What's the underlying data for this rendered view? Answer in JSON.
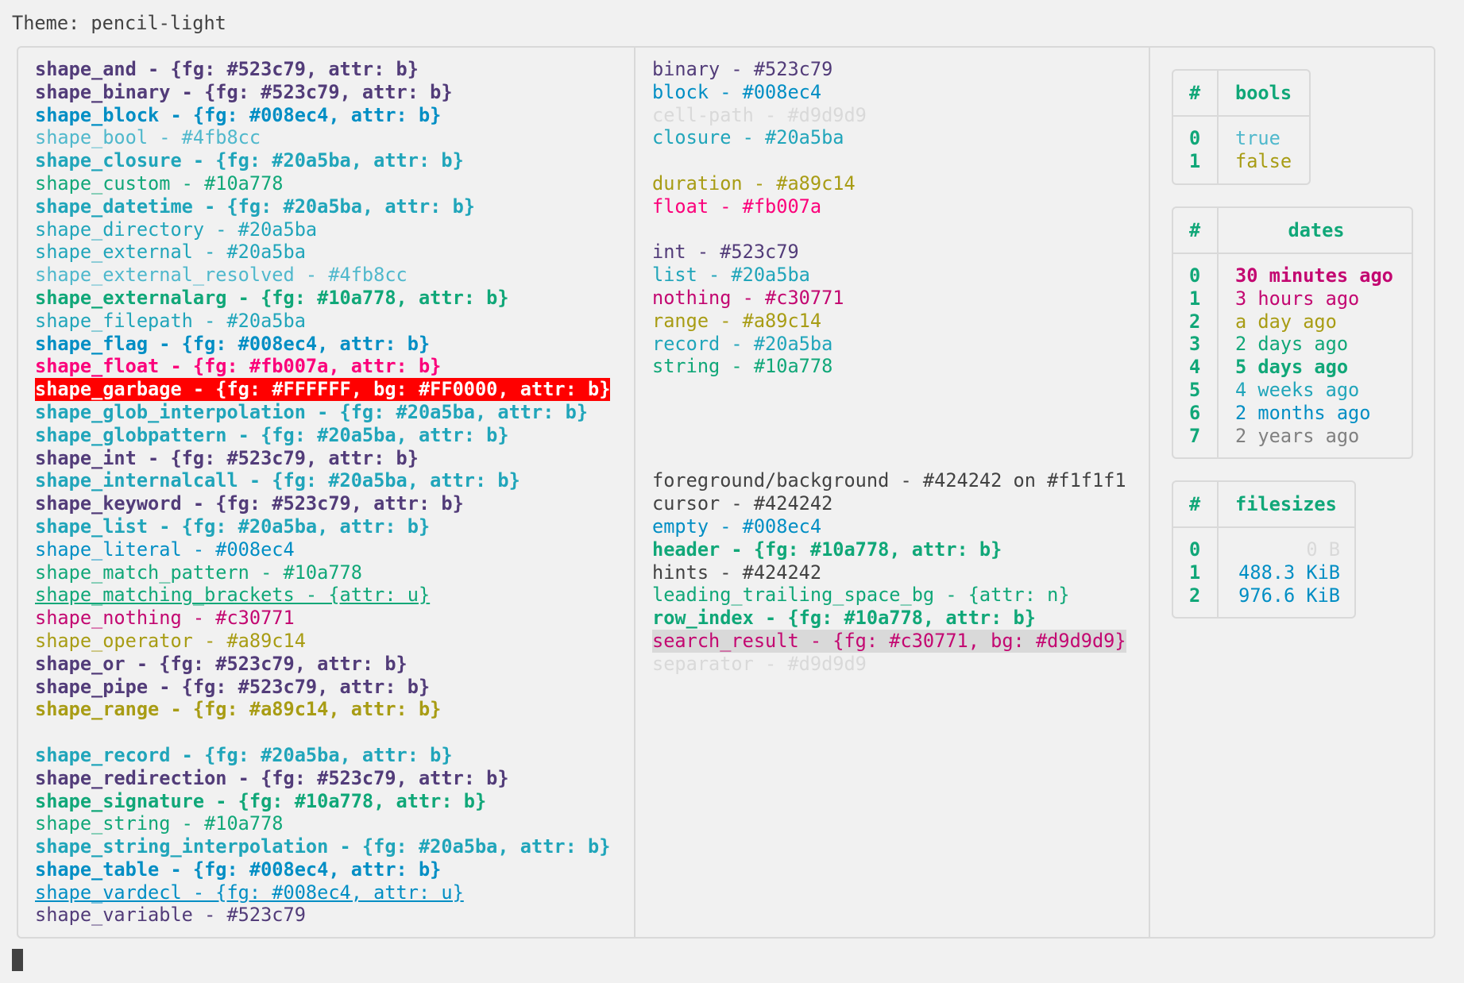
{
  "title": "Theme: pencil-light",
  "col1": [
    {
      "text": "shape_and - {fg: #523c79, attr: b}",
      "color": "#523c79",
      "style": "b"
    },
    {
      "text": "shape_binary - {fg: #523c79, attr: b}",
      "color": "#523c79",
      "style": "b"
    },
    {
      "text": "shape_block - {fg: #008ec4, attr: b}",
      "color": "#008ec4",
      "style": "b"
    },
    {
      "text": "shape_bool - #4fb8cc",
      "color": "#4fb8cc",
      "style": ""
    },
    {
      "text": "shape_closure - {fg: #20a5ba, attr: b}",
      "color": "#20a5ba",
      "style": "b"
    },
    {
      "text": "shape_custom - #10a778",
      "color": "#10a778",
      "style": ""
    },
    {
      "text": "shape_datetime - {fg: #20a5ba, attr: b}",
      "color": "#20a5ba",
      "style": "b"
    },
    {
      "text": "shape_directory - #20a5ba",
      "color": "#20a5ba",
      "style": ""
    },
    {
      "text": "shape_external - #20a5ba",
      "color": "#20a5ba",
      "style": ""
    },
    {
      "text": "shape_external_resolved - #4fb8cc",
      "color": "#4fb8cc",
      "style": ""
    },
    {
      "text": "shape_externalarg - {fg: #10a778, attr: b}",
      "color": "#10a778",
      "style": "b"
    },
    {
      "text": "shape_filepath - #20a5ba",
      "color": "#20a5ba",
      "style": ""
    },
    {
      "text": "shape_flag - {fg: #008ec4, attr: b}",
      "color": "#008ec4",
      "style": "b"
    },
    {
      "text": "shape_float - {fg: #fb007a, attr: b}",
      "color": "#fb007a",
      "style": "b"
    },
    {
      "text": "shape_garbage - {fg: #FFFFFF, bg: #FF0000, attr: b}",
      "color": "#FFFFFF",
      "style": "garb"
    },
    {
      "text": "shape_glob_interpolation - {fg: #20a5ba, attr: b}",
      "color": "#20a5ba",
      "style": "b"
    },
    {
      "text": "shape_globpattern - {fg: #20a5ba, attr: b}",
      "color": "#20a5ba",
      "style": "b"
    },
    {
      "text": "shape_int - {fg: #523c79, attr: b}",
      "color": "#523c79",
      "style": "b"
    },
    {
      "text": "shape_internalcall - {fg: #20a5ba, attr: b}",
      "color": "#20a5ba",
      "style": "b"
    },
    {
      "text": "shape_keyword - {fg: #523c79, attr: b}",
      "color": "#523c79",
      "style": "b"
    },
    {
      "text": "shape_list - {fg: #20a5ba, attr: b}",
      "color": "#20a5ba",
      "style": "b"
    },
    {
      "text": "shape_literal - #008ec4",
      "color": "#008ec4",
      "style": ""
    },
    {
      "text": "shape_match_pattern - #10a778",
      "color": "#10a778",
      "style": ""
    },
    {
      "text": "shape_matching_brackets - {attr: u}",
      "color": "#10a778",
      "style": "u"
    },
    {
      "text": "shape_nothing - #c30771",
      "color": "#c30771",
      "style": ""
    },
    {
      "text": "shape_operator - #a89c14",
      "color": "#a89c14",
      "style": ""
    },
    {
      "text": "shape_or - {fg: #523c79, attr: b}",
      "color": "#523c79",
      "style": "b"
    },
    {
      "text": "shape_pipe - {fg: #523c79, attr: b}",
      "color": "#523c79",
      "style": "b"
    },
    {
      "text": "shape_range - {fg: #a89c14, attr: b}",
      "color": "#a89c14",
      "style": "b"
    },
    {
      "text": "",
      "color": "#424242",
      "style": ""
    },
    {
      "text": "shape_record - {fg: #20a5ba, attr: b}",
      "color": "#20a5ba",
      "style": "b"
    },
    {
      "text": "shape_redirection - {fg: #523c79, attr: b}",
      "color": "#523c79",
      "style": "b"
    },
    {
      "text": "shape_signature - {fg: #10a778, attr: b}",
      "color": "#10a778",
      "style": "b"
    },
    {
      "text": "shape_string - #10a778",
      "color": "#10a778",
      "style": ""
    },
    {
      "text": "shape_string_interpolation - {fg: #20a5ba, attr: b}",
      "color": "#20a5ba",
      "style": "b"
    },
    {
      "text": "shape_table - {fg: #008ec4, attr: b}",
      "color": "#008ec4",
      "style": "b"
    },
    {
      "text": "shape_vardecl - {fg: #008ec4, attr: u}",
      "color": "#008ec4",
      "style": "u"
    },
    {
      "text": "shape_variable - #523c79",
      "color": "#523c79",
      "style": ""
    }
  ],
  "col2": [
    {
      "text": "binary - #523c79",
      "color": "#523c79",
      "style": ""
    },
    {
      "text": "block - #008ec4",
      "color": "#008ec4",
      "style": ""
    },
    {
      "text": "cell-path - #d9d9d9",
      "color": "#d9d9d9",
      "style": ""
    },
    {
      "text": "closure - #20a5ba",
      "color": "#20a5ba",
      "style": ""
    },
    {
      "text": "",
      "color": "#424242",
      "style": ""
    },
    {
      "text": "duration - #a89c14",
      "color": "#a89c14",
      "style": ""
    },
    {
      "text": "float - #fb007a",
      "color": "#fb007a",
      "style": ""
    },
    {
      "text": "",
      "color": "#424242",
      "style": ""
    },
    {
      "text": "int - #523c79",
      "color": "#523c79",
      "style": ""
    },
    {
      "text": "list - #20a5ba",
      "color": "#20a5ba",
      "style": ""
    },
    {
      "text": "nothing - #c30771",
      "color": "#c30771",
      "style": ""
    },
    {
      "text": "range - #a89c14",
      "color": "#a89c14",
      "style": ""
    },
    {
      "text": "record - #20a5ba",
      "color": "#20a5ba",
      "style": ""
    },
    {
      "text": "string - #10a778",
      "color": "#10a778",
      "style": ""
    },
    {
      "text": "",
      "color": "#424242",
      "style": ""
    },
    {
      "text": "",
      "color": "#424242",
      "style": ""
    },
    {
      "text": "",
      "color": "#424242",
      "style": ""
    },
    {
      "text": "",
      "color": "#424242",
      "style": ""
    },
    {
      "text": "foreground/background - #424242 on #f1f1f1",
      "color": "#424242",
      "style": ""
    },
    {
      "text": "cursor - #424242",
      "color": "#424242",
      "style": ""
    },
    {
      "text": "empty - #008ec4",
      "color": "#008ec4",
      "style": ""
    },
    {
      "text": "header - {fg: #10a778, attr: b}",
      "color": "#10a778",
      "style": "b"
    },
    {
      "text": "hints - #424242",
      "color": "#424242",
      "style": ""
    },
    {
      "text": "leading_trailing_space_bg - {attr: n}",
      "color": "#10a778",
      "style": ""
    },
    {
      "text": "row_index - {fg: #10a778, attr: b}",
      "color": "#10a778",
      "style": "b"
    },
    {
      "text": "search_result - {fg: #c30771, bg: #d9d9d9}",
      "color": "#c30771",
      "style": "sr"
    },
    {
      "text": "separator - #d9d9d9",
      "color": "#d9d9d9",
      "style": ""
    }
  ],
  "tables": {
    "bools": {
      "index_header": "#",
      "header": "bools",
      "rows": [
        {
          "idx": "0",
          "val": "true",
          "color": "#4fb8cc",
          "bold": false
        },
        {
          "idx": "1",
          "val": "false",
          "color": "#a89c14",
          "bold": false
        }
      ]
    },
    "dates": {
      "index_header": "#",
      "header": "dates",
      "rows": [
        {
          "idx": "0",
          "val": "30 minutes ago",
          "color": "#c30771",
          "bold": true
        },
        {
          "idx": "1",
          "val": "3 hours ago",
          "color": "#c30771",
          "bold": false
        },
        {
          "idx": "2",
          "val": "a day ago",
          "color": "#a89c14",
          "bold": false
        },
        {
          "idx": "3",
          "val": "2 days ago",
          "color": "#10a778",
          "bold": false
        },
        {
          "idx": "4",
          "val": "5 days ago",
          "color": "#10a778",
          "bold": true
        },
        {
          "idx": "5",
          "val": "4 weeks ago",
          "color": "#20a5ba",
          "bold": false
        },
        {
          "idx": "6",
          "val": "2 months ago",
          "color": "#008ec4",
          "bold": false
        },
        {
          "idx": "7",
          "val": "2 years ago",
          "color": "#808080",
          "bold": false
        }
      ]
    },
    "filesizes": {
      "index_header": "#",
      "header": "filesizes",
      "rows": [
        {
          "idx": "0",
          "val": "0 B",
          "color": "#d9d9d9",
          "bold": false
        },
        {
          "idx": "1",
          "val": "488.3 KiB",
          "color": "#008ec4",
          "bold": false
        },
        {
          "idx": "2",
          "val": "976.6 KiB",
          "color": "#008ec4",
          "bold": false
        }
      ]
    }
  },
  "colors": {
    "background": "#f1f1f1",
    "foreground": "#424242",
    "separator": "#d9d9d9",
    "header": "#10a778",
    "row_index": "#10a778"
  }
}
